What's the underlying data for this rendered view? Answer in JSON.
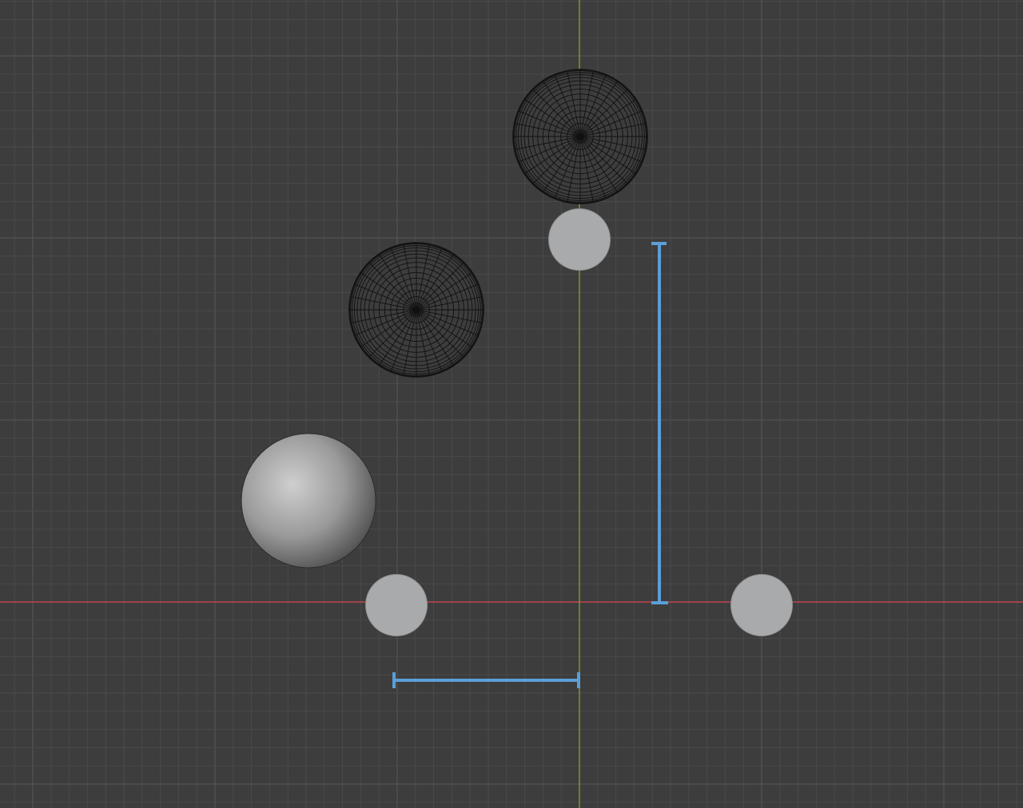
{
  "viewport": {
    "mode": "top-orthographic",
    "colors": {
      "background": "#3d3d3d",
      "grid_minor": "#474747",
      "grid_major": "#555555",
      "x_axis": "#c0454f",
      "y_axis": "#7a9a28",
      "measure": "#5b9fd6",
      "wire": "#111111",
      "flat_disc": "#a9aaab"
    }
  },
  "objects": [
    {
      "name": "sphere-wireframe-top",
      "shading": "wireframe"
    },
    {
      "name": "sphere-wireframe-mid",
      "shading": "wireframe"
    },
    {
      "name": "sphere-solid",
      "shading": "solid"
    },
    {
      "name": "disc-top",
      "shading": "flat"
    },
    {
      "name": "disc-left",
      "shading": "flat"
    },
    {
      "name": "disc-right",
      "shading": "flat"
    }
  ],
  "measurements": [
    {
      "name": "vertical-measure",
      "orientation": "vertical"
    },
    {
      "name": "horizontal-measure",
      "orientation": "horizontal"
    }
  ]
}
